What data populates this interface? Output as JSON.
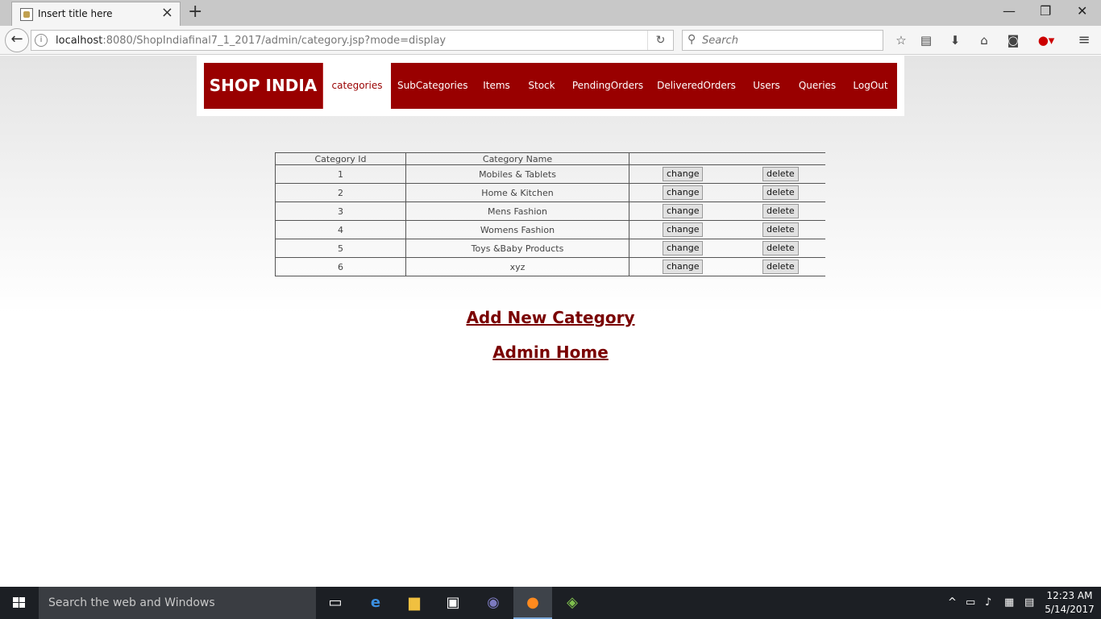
{
  "browser": {
    "tab_title": "Insert title here",
    "url_host": "localhost",
    "url_rest": ":8080/ShopIndiafinal7_1_2017/admin/category.jsp?mode=display",
    "search_placeholder": "Search"
  },
  "site": {
    "logo": "SHOP INDIA",
    "menu": [
      "categories",
      "SubCategories",
      "Items",
      "Stock",
      "PendingOrders",
      "DeliveredOrders",
      "Users",
      "Queries",
      "LogOut"
    ],
    "active_menu": "categories"
  },
  "table": {
    "headers": [
      "Category Id",
      "Category Name",
      ""
    ],
    "rows": [
      {
        "id": "1",
        "name": "Mobiles & Tablets"
      },
      {
        "id": "2",
        "name": "Home & Kitchen"
      },
      {
        "id": "3",
        "name": "Mens Fashion"
      },
      {
        "id": "4",
        "name": "Womens Fashion"
      },
      {
        "id": "5",
        "name": "Toys &Baby Products"
      },
      {
        "id": "6",
        "name": "xyz"
      }
    ],
    "change_label": "change",
    "delete_label": "delete"
  },
  "links": {
    "add_category": "Add New Category",
    "admin_home": "Admin Home"
  },
  "taskbar": {
    "search_placeholder": "Search the web and Windows",
    "time": "12:23 AM",
    "date": "5/14/2017"
  },
  "colors": {
    "brand": "#990000",
    "link": "#7a0000"
  }
}
